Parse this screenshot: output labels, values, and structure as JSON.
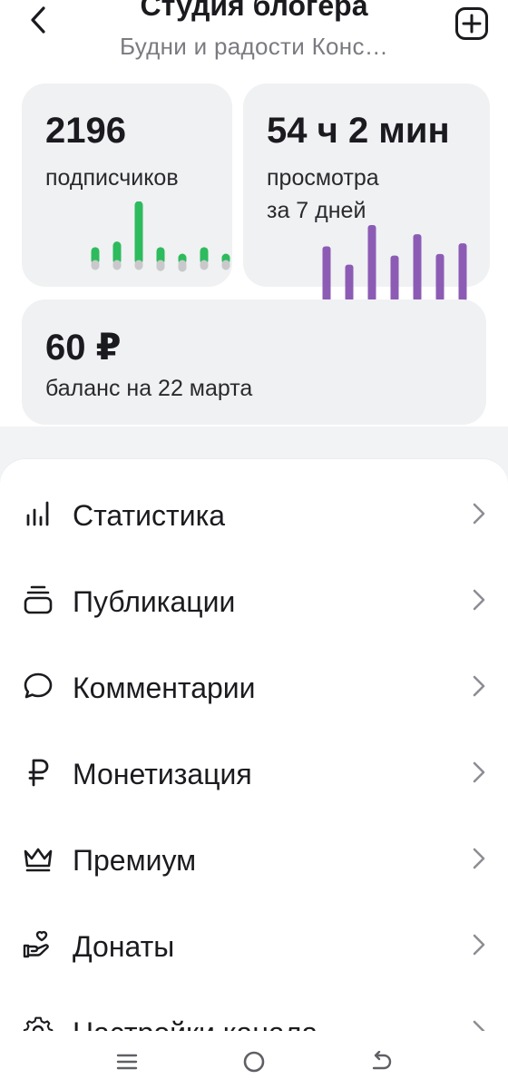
{
  "header": {
    "title": "Студия блогера",
    "subtitle": "Будни и радости Конс…",
    "back_icon": "chevron-left-icon",
    "add_icon": "plus-square-icon"
  },
  "stats": {
    "subscribers": {
      "value": "2196",
      "label": "подписчиков",
      "accent_color": "#2dbb5d",
      "negative_color": "#c9c9cc",
      "bars": [
        {
          "up": 0.18,
          "down": 0.06
        },
        {
          "up": 0.28,
          "down": 0.06
        },
        {
          "up": 1.0,
          "down": 0.06
        },
        {
          "up": 0.18,
          "down": 0.18
        },
        {
          "up": 0.06,
          "down": 0.22
        },
        {
          "up": 0.18,
          "down": 0.1
        },
        {
          "up": 0.06,
          "down": 0.06
        }
      ]
    },
    "views": {
      "value": "54 ч 2 мин",
      "label_line1": "просмотра",
      "label_line2": "за 7 дней",
      "accent_color": "#8c5cb5",
      "bars": [
        0.72,
        0.48,
        1.0,
        0.6,
        0.88,
        0.62,
        0.76
      ]
    },
    "balance": {
      "value": "60 ₽",
      "label": "баланс на 22 марта"
    }
  },
  "menu": {
    "items": [
      {
        "label": "Статистика",
        "icon": "bar-chart-icon"
      },
      {
        "label": "Публикации",
        "icon": "publications-stack-icon"
      },
      {
        "label": "Комментарии",
        "icon": "comment-bubble-icon"
      },
      {
        "label": "Монетизация",
        "icon": "ruble-icon"
      },
      {
        "label": "Премиум",
        "icon": "crown-icon"
      },
      {
        "label": "Донаты",
        "icon": "hand-heart-icon"
      },
      {
        "label": "Настройки канала",
        "icon": "gear-icon"
      }
    ]
  },
  "navbar": {
    "recents_icon": "recents-icon",
    "home_icon": "home-circle-icon",
    "back_icon": "back-arrow-icon"
  }
}
